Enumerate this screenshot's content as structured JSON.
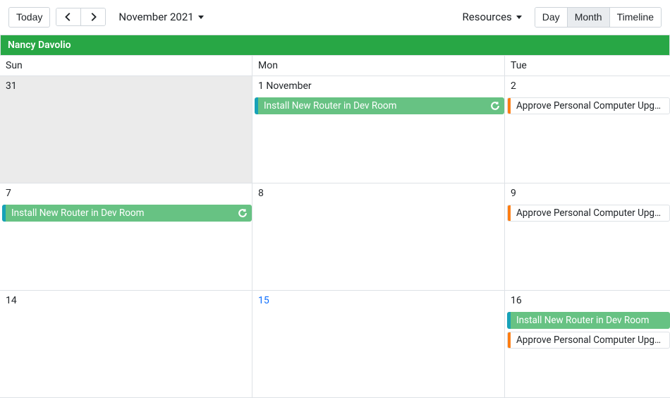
{
  "toolbar": {
    "today_label": "Today",
    "month_picker_label": "November 2021",
    "resources_label": "Resources",
    "views": {
      "day": "Day",
      "month": "Month",
      "timeline": "Timeline"
    }
  },
  "resource_name": "Nancy Davolio",
  "day_headers": {
    "sun": "Sun",
    "mon": "Mon",
    "tue": "Tue"
  },
  "weeks": [
    {
      "sun": {
        "label": "31",
        "other_month": true,
        "events": []
      },
      "mon": {
        "label": "1 November",
        "events": [
          {
            "style": "green",
            "stripe": "#17a2b8",
            "title": "Install New Router in Dev Room",
            "recurring": true
          }
        ]
      },
      "tue": {
        "label": "2",
        "events": [
          {
            "style": "plain",
            "stripe": "#fd7e14",
            "title": "Approve Personal Computer Upgrade Plan",
            "recurring": false
          }
        ]
      }
    },
    {
      "sun": {
        "label": "7",
        "events": [
          {
            "style": "green",
            "stripe": "#17a2b8",
            "title": "Install New Router in Dev Room",
            "recurring": true
          }
        ]
      },
      "mon": {
        "label": "8",
        "events": []
      },
      "tue": {
        "label": "9",
        "events": [
          {
            "style": "plain",
            "stripe": "#fd7e14",
            "title": "Approve Personal Computer Upgrade Plan",
            "recurring": false
          }
        ]
      }
    },
    {
      "sun": {
        "label": "14",
        "events": []
      },
      "mon": {
        "label": "15",
        "link": true,
        "events": []
      },
      "tue": {
        "label": "16",
        "events": [
          {
            "style": "green",
            "stripe": "#17a2b8",
            "title": "Install New Router in Dev Room",
            "recurring": false
          },
          {
            "style": "plain",
            "stripe": "#fd7e14",
            "title": "Approve Personal Computer Upgrade Plan",
            "recurring": false
          }
        ]
      }
    }
  ]
}
